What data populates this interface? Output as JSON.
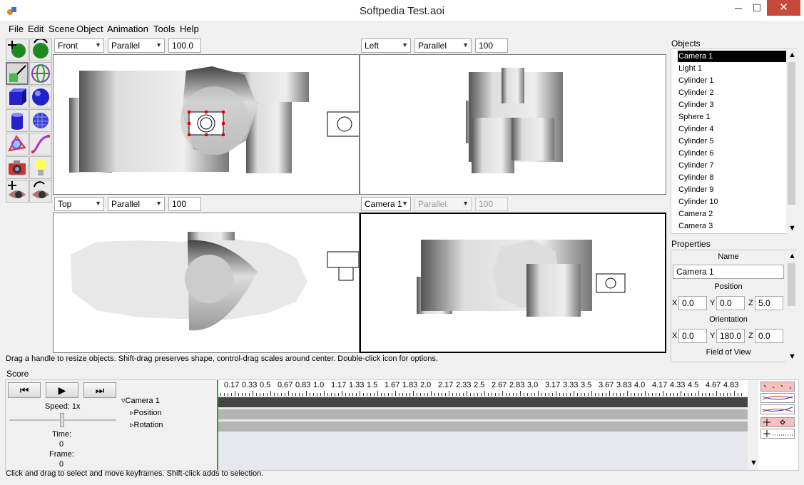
{
  "window": {
    "title": "Softpedia Test.aoi",
    "minimize_glyph": "─",
    "maximize_glyph": "☐",
    "close_glyph": "✕"
  },
  "menu": [
    "File",
    "Edit",
    "Scene",
    "Object",
    "Animation",
    "Tools",
    "Help"
  ],
  "viewports": [
    {
      "view": "Front",
      "projection": "Parallel",
      "scale": "100.0"
    },
    {
      "view": "Left",
      "projection": "Parallel",
      "scale": "100"
    },
    {
      "view": "Top",
      "projection": "Parallel",
      "scale": "100"
    },
    {
      "view": "Camera 1",
      "projection": "Parallel",
      "scale": "100"
    }
  ],
  "status_top": "Drag a handle to resize objects.  Shift-drag preserves shape, control-drag scales around center.  Double-click icon for options.",
  "objects": {
    "header": "Objects",
    "items": [
      "Camera 1",
      "Light 1",
      "Cylinder 1",
      "Cylinder 2",
      "Cylinder 3",
      "Sphere 1",
      "Cylinder 4",
      "Cylinder 5",
      "Cylinder 6",
      "Cylinder 7",
      "Cylinder 8",
      "Cylinder 9",
      "Cylinder 10",
      "Camera 2",
      "Camera 3"
    ],
    "selected": "Camera 1"
  },
  "properties": {
    "header": "Properties",
    "name_label": "Name",
    "name_value": "Camera 1",
    "position_label": "Position",
    "position": {
      "x": "0.0",
      "y": "0.0",
      "z": "5.0"
    },
    "orientation_label": "Orientation",
    "orientation": {
      "x": "0.0",
      "y": "180.0",
      "z": "0.0"
    },
    "fov_label": "Field of View",
    "axis_x": "X",
    "axis_y": "Y",
    "axis_z": "Z"
  },
  "score": {
    "label": "Score",
    "speed": "Speed: 1x",
    "time_label": "Time:",
    "time_value": "0",
    "frame_label": "Frame:",
    "frame_value": "0",
    "tracks": [
      "Camera 1",
      "Position",
      "Rotation"
    ],
    "ticks": [
      "0.17",
      "0.33",
      "0.5",
      "0.67",
      "0.83",
      "1.0",
      "1.17",
      "1.33",
      "1.5",
      "1.67",
      "1.83",
      "2.0",
      "2.17",
      "2.33",
      "2.5",
      "2.67",
      "2.83",
      "3.0",
      "3.17",
      "3.33",
      "3.5",
      "3.67",
      "3.83",
      "4.0",
      "4.17",
      "4.33",
      "4.5",
      "4.67",
      "4.83"
    ]
  },
  "status_bottom": "Click and drag to select and move keyframes.  Shift-click adds to selection.",
  "colors": {
    "accent_selection": "#000000",
    "close_button": "#c7493c"
  }
}
